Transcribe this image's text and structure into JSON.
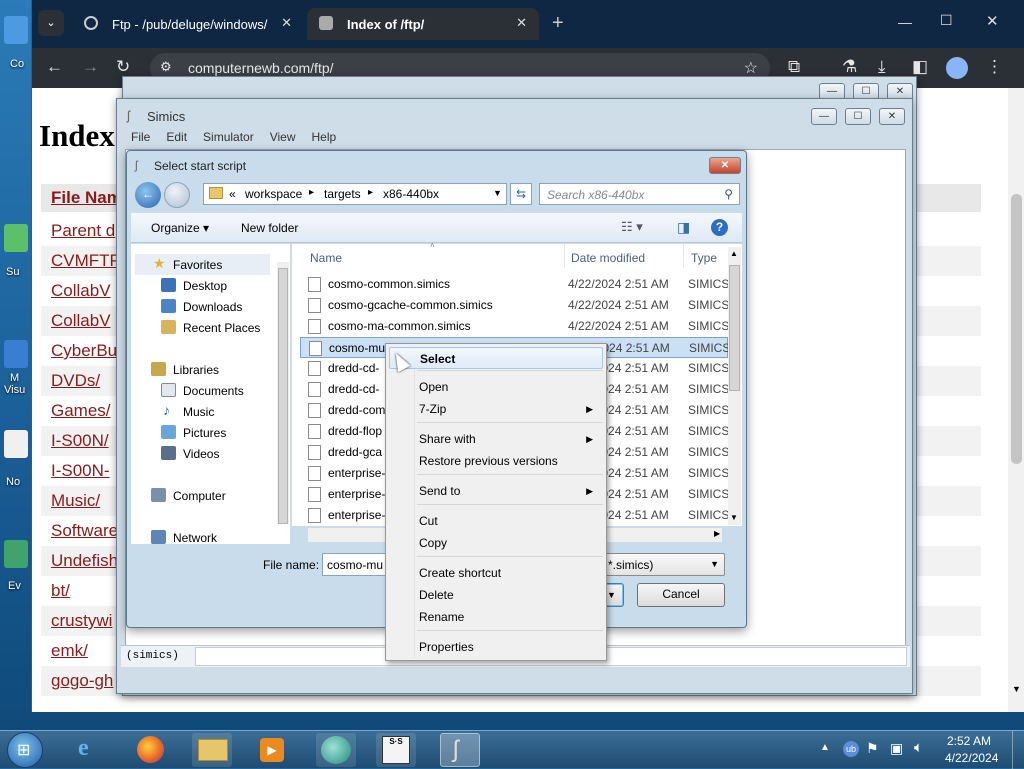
{
  "desktop": {
    "icons": [
      "Co",
      "Su",
      "M\nVisu",
      "No",
      "Ev"
    ]
  },
  "browser": {
    "tabs": [
      {
        "title": "Ftp - /pub/deluge/windows/ :"
      },
      {
        "title": "Index of /ftp/"
      }
    ],
    "new_tab": "+",
    "url": "computernewb.com/ftp/",
    "window_controls": {
      "minimize": "—",
      "maximize": "☐",
      "close": "✕"
    }
  },
  "webpage": {
    "heading": "Index",
    "column_header": "File Nam",
    "links": [
      "Parent d",
      "CVMFTP",
      "CollabV",
      "CollabV",
      "CyberBu",
      "DVDs/",
      "Games/",
      "I-S00N/",
      "I-S00N-",
      "Music/",
      "Software",
      "Undefish",
      "bt/",
      "crustywi",
      "emk/",
      "gogo-gh"
    ]
  },
  "simics_back": {
    "title": ""
  },
  "simics": {
    "title": "Simics",
    "menu": [
      "File",
      "Edit",
      "Simulator",
      "View",
      "Help"
    ],
    "console_prompt": "(simics)"
  },
  "dialog": {
    "title": "Select start script",
    "breadcrumb": [
      "«",
      "workspace",
      "targets",
      "x86-440bx"
    ],
    "search_placeholder": "Search x86-440bx",
    "organize": "Organize ▾",
    "new_folder": "New folder",
    "nav": {
      "favorites": "Favorites",
      "desktop": "Desktop",
      "downloads": "Downloads",
      "recent": "Recent Places",
      "libraries": "Libraries",
      "documents": "Documents",
      "music": "Music",
      "pictures": "Pictures",
      "videos": "Videos",
      "computer": "Computer",
      "network": "Network"
    },
    "columns": {
      "name": "Name",
      "date": "Date modified",
      "type": "Type"
    },
    "files": [
      {
        "name": "cosmo-common.simics",
        "date": "4/22/2024 2:51 AM",
        "type": "SIMICS"
      },
      {
        "name": "cosmo-gcache-common.simics",
        "date": "4/22/2024 2:51 AM",
        "type": "SIMICS"
      },
      {
        "name": "cosmo-ma-common.simics",
        "date": "4/22/2024 2:51 AM",
        "type": "SIMICS"
      },
      {
        "name": "cosmo-mu",
        "date": "4/22/2024 2:51 AM",
        "type": "SIMICS"
      },
      {
        "name": "dredd-cd-",
        "date": "4/22/2024 2:51 AM",
        "type": "SIMICS"
      },
      {
        "name": "dredd-cd-",
        "date": "4/22/2024 2:51 AM",
        "type": "SIMICS"
      },
      {
        "name": "dredd-com",
        "date": "4/22/2024 2:51 AM",
        "type": "SIMICS"
      },
      {
        "name": "dredd-flop",
        "date": "4/22/2024 2:51 AM",
        "type": "SIMICS"
      },
      {
        "name": "dredd-gca",
        "date": "4/22/2024 2:51 AM",
        "type": "SIMICS"
      },
      {
        "name": "enterprise-",
        "date": "4/22/2024 2:51 AM",
        "type": "SIMICS"
      },
      {
        "name": "enterprise-",
        "date": "4/22/2024 2:51 AM",
        "type": "SIMICS"
      },
      {
        "name": "enterprise-",
        "date": "4/22/2024 2:51 AM",
        "type": "SIMICS"
      }
    ],
    "filename_label": "File name:",
    "filename_value": "cosmo-mu",
    "filter_value": "*.simics)",
    "cancel": "Cancel"
  },
  "context_menu": {
    "items": [
      {
        "label": "Select",
        "bold": true
      },
      {
        "label": "Open"
      },
      {
        "label": "7-Zip",
        "submenu": true
      },
      {
        "label": "Share with",
        "submenu": true
      },
      {
        "label": "Restore previous versions"
      },
      {
        "label": "Send to",
        "submenu": true
      },
      {
        "label": "Cut"
      },
      {
        "label": "Copy"
      },
      {
        "label": "Create shortcut"
      },
      {
        "label": "Delete"
      },
      {
        "label": "Rename"
      },
      {
        "label": "Properties"
      }
    ]
  },
  "taskbar": {
    "time": "2:52 AM",
    "date": "4/22/2024"
  },
  "colors": {
    "link": "#8b1a1a",
    "chrome_dark": "#2b2f36",
    "dialog_bg": "#c9dcec",
    "selection": "#cce0f5"
  }
}
